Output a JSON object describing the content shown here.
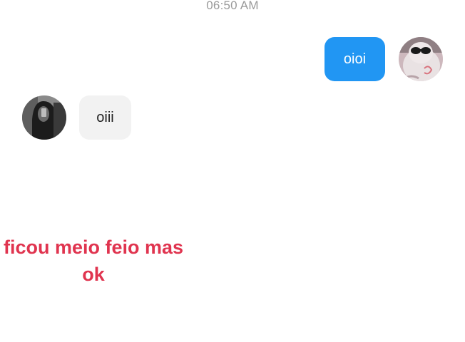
{
  "chat": {
    "timestamp": "06:50 AM",
    "messages": [
      {
        "sender": "self",
        "text": "oioi"
      },
      {
        "sender": "other",
        "text": "oiii"
      }
    ]
  },
  "overlay": {
    "caption_line1": "ficou meio feio mas",
    "caption_line2": "ok"
  },
  "colors": {
    "sent_bubble": "#2196f3",
    "received_bubble": "#f2f2f2",
    "caption": "#e0344f",
    "timestamp": "#9a9a9a"
  },
  "icons": {
    "self_avatar": "user-avatar-icon",
    "other_avatar": "user-avatar-icon"
  }
}
